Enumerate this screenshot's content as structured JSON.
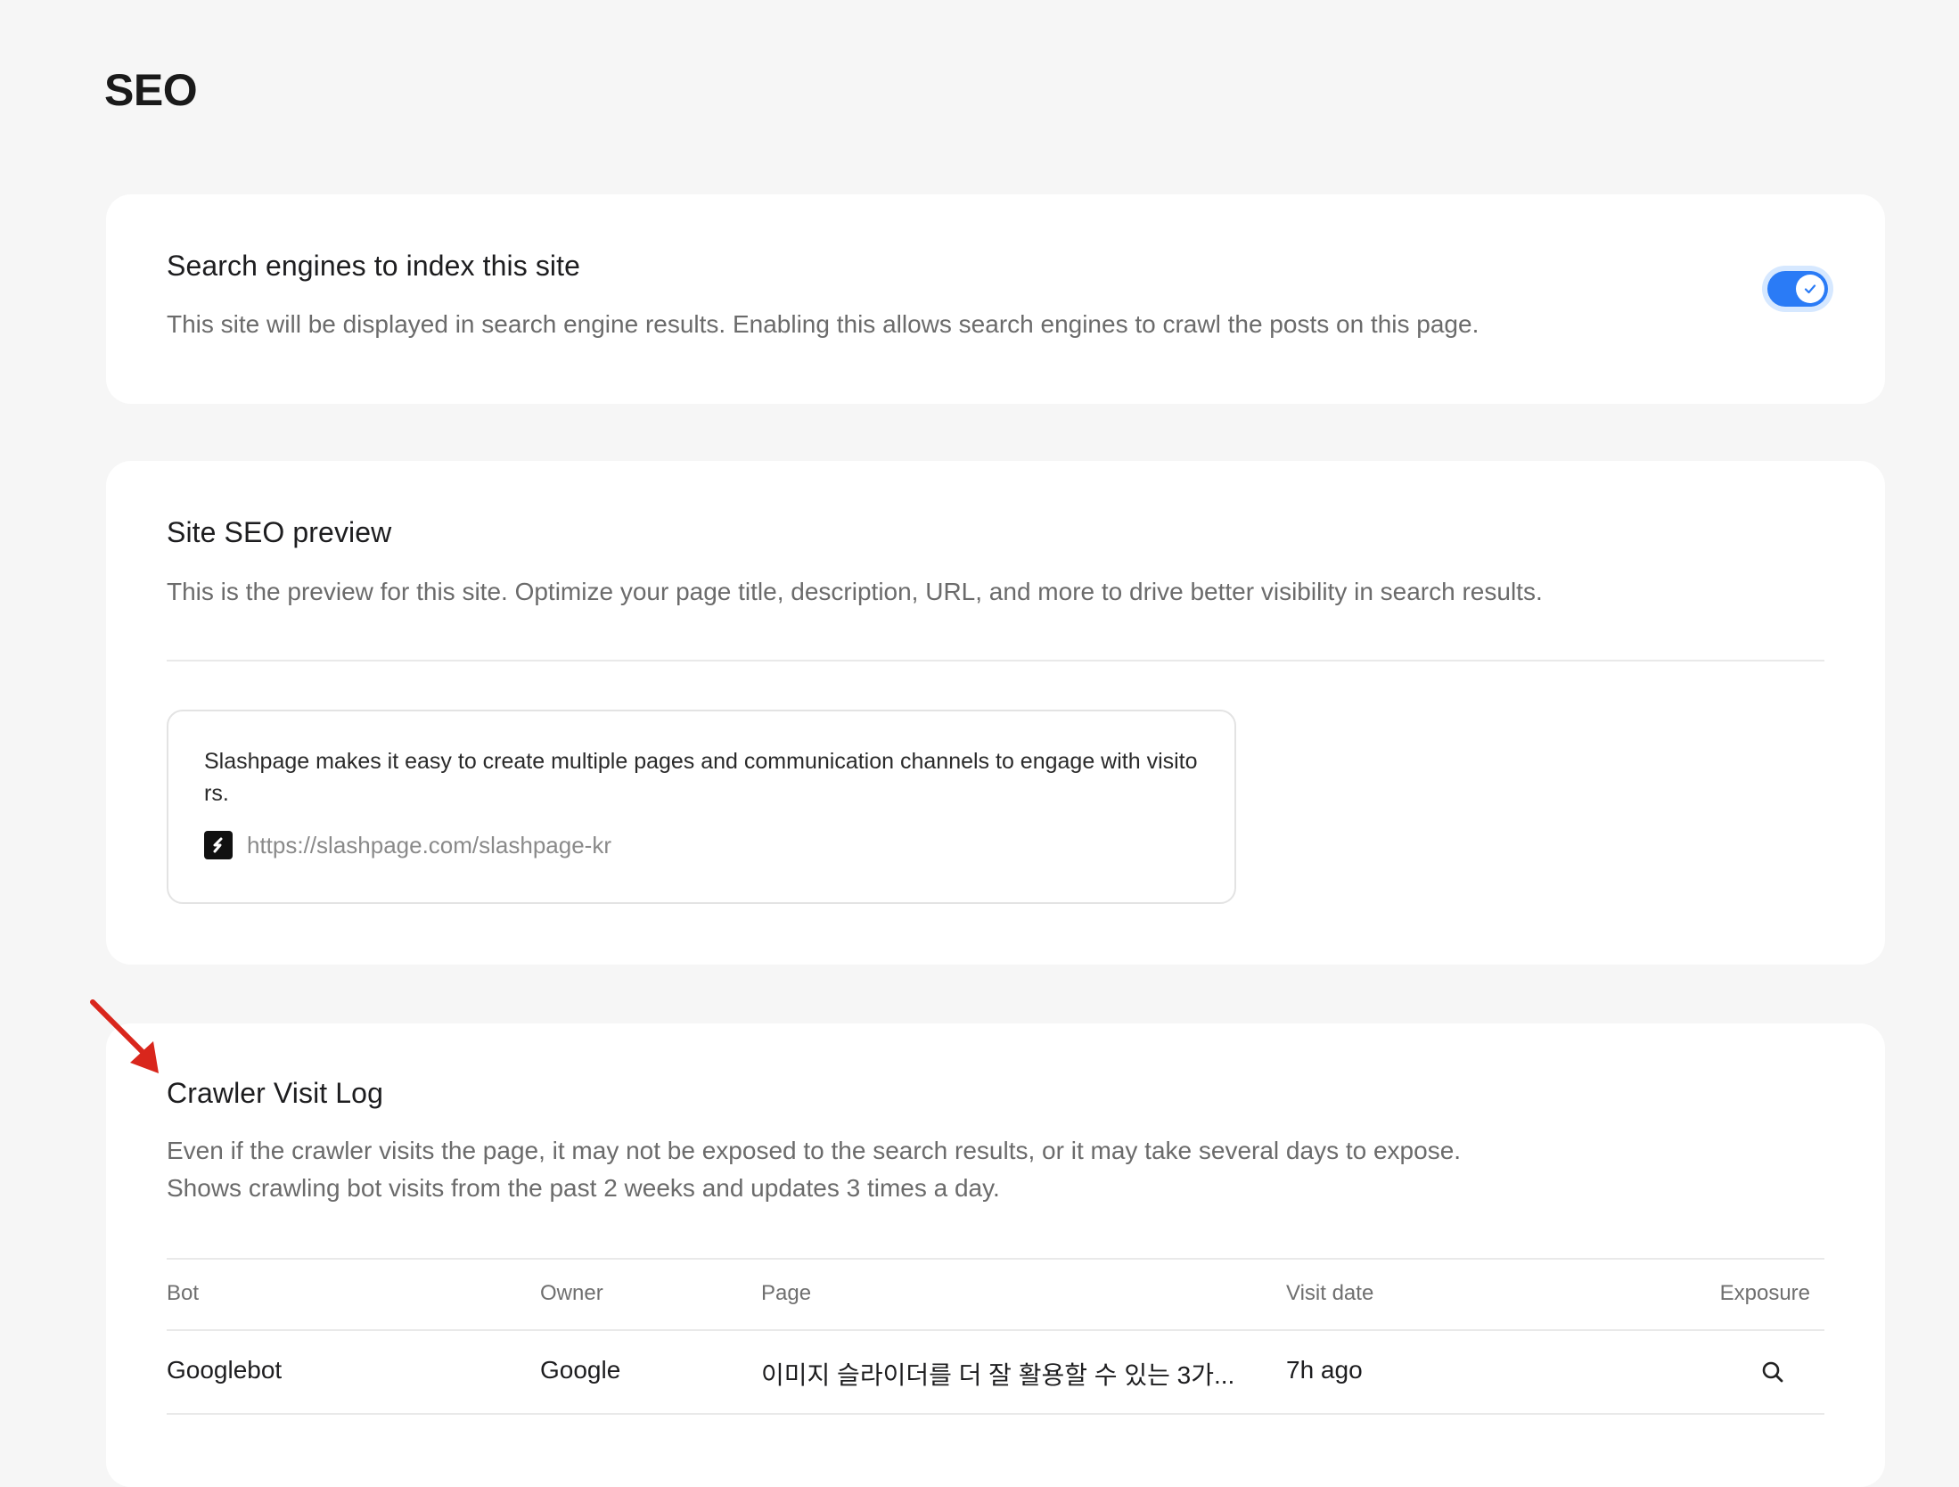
{
  "page": {
    "title": "SEO"
  },
  "indexing": {
    "title": "Search engines to index this site",
    "description": "This site will be displayed in search engine results. Enabling this allows search engines to crawl the posts on this page.",
    "enabled": true,
    "accent_color": "#2a7bf6"
  },
  "seo_preview": {
    "title": "Site SEO preview",
    "description": "This is the preview for this site. Optimize your page title, description, URL, and more to drive better visibility in search results.",
    "preview": {
      "description": "Slashpage makes it easy to create multiple pages and communication channels to engage with visitors.",
      "url": "https://slashpage.com/slashpage-kr",
      "icon": "slashpage-logo-icon"
    }
  },
  "crawler_log": {
    "title": "Crawler Visit Log",
    "description_line1": "Even if the crawler visits the page, it may not be exposed to the search results, or it may take several days to expose.",
    "description_line2": "Shows crawling bot visits from the past 2 weeks and updates 3 times a day.",
    "columns": {
      "bot": "Bot",
      "owner": "Owner",
      "page": "Page",
      "visit_date": "Visit date",
      "exposure": "Exposure"
    },
    "rows": [
      {
        "bot": "Googlebot",
        "owner": "Google",
        "page": "이미지 슬라이더를 더 잘 활용할 수 있는 3가...",
        "visit_date": "7h ago",
        "exposure_icon": "search-icon"
      }
    ]
  },
  "annotation": {
    "arrow_color": "#d9261c"
  }
}
